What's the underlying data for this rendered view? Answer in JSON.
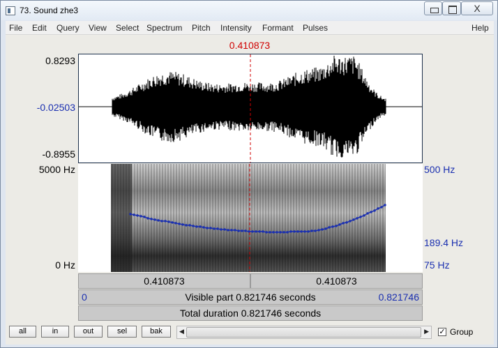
{
  "window": {
    "title": "73. Sound zhe3",
    "close_symbol": "X"
  },
  "menu": {
    "items": [
      "File",
      "Edit",
      "Query",
      "View",
      "Select",
      "Spectrum",
      "Pitch",
      "Intensity",
      "Formant",
      "Pulses"
    ],
    "help": "Help"
  },
  "cursor": {
    "time": "0.410873"
  },
  "waveform": {
    "y_max": "0.8293",
    "y_mid": "-0.02503",
    "y_min": "-0.8955"
  },
  "spectrogram": {
    "freq_max": "5000 Hz",
    "freq_min": "0 Hz",
    "pitch_max": "500 Hz",
    "pitch_cursor": "189.4 Hz",
    "pitch_min": "75 Hz"
  },
  "time_bars": {
    "left_part": "0.410873",
    "right_part": "0.410873",
    "visible_start": "0",
    "visible_label": "Visible part 0.821746 seconds",
    "visible_end": "0.821746",
    "total_label": "Total duration 0.821746 seconds"
  },
  "buttons": {
    "all": "all",
    "in": "in",
    "out": "out",
    "sel": "sel",
    "bak": "bak"
  },
  "group": {
    "label": "Group",
    "checked": true,
    "check_symbol": "✓"
  },
  "colors": {
    "cursor": "#d00000",
    "pitch": "#1a2fb0",
    "wave": "#000000"
  }
}
